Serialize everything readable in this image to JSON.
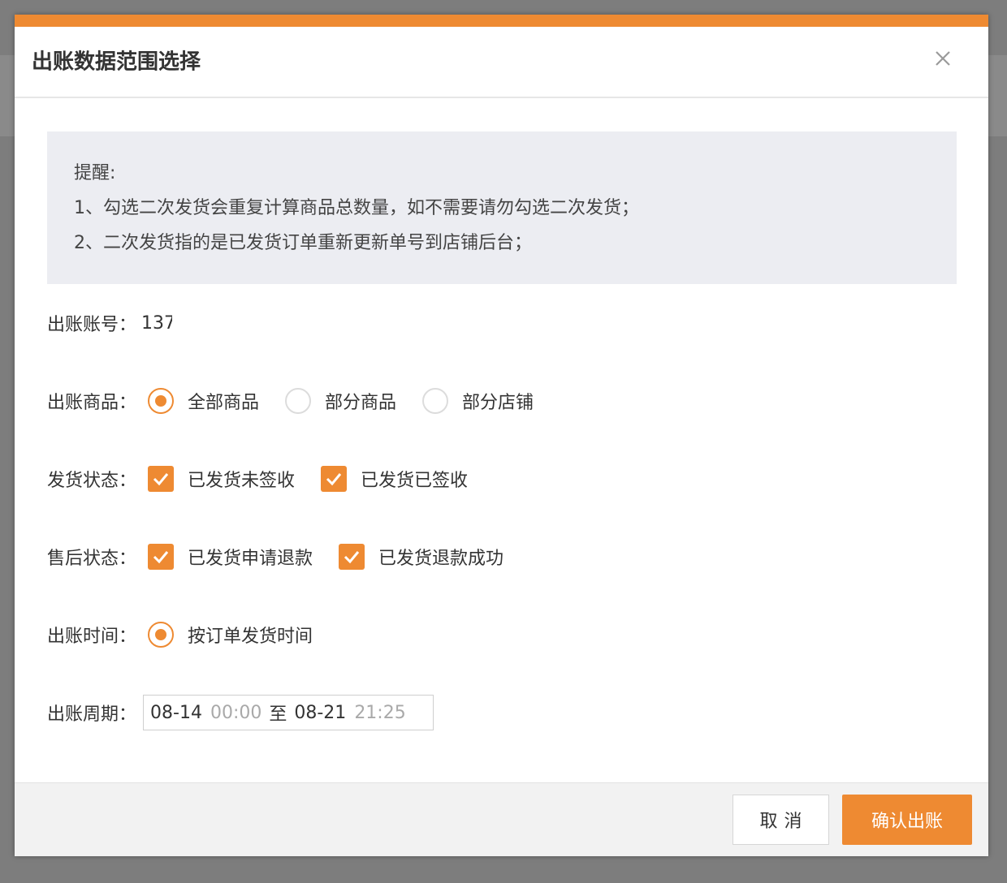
{
  "dialog": {
    "title": "出账数据范围选择",
    "accent_color": "#ee8a32"
  },
  "notice": {
    "title": "提醒:",
    "lines": [
      "1、勾选二次发货会重复计算商品总数量，如不需要请勿勾选二次发货；",
      "2、二次发货指的是已发货订单重新更新单号到店铺后台；"
    ]
  },
  "form": {
    "account": {
      "label": "出账账号：",
      "value": "137"
    },
    "goods": {
      "label": "出账商品：",
      "options": [
        {
          "label": "全部商品",
          "checked": true
        },
        {
          "label": "部分商品",
          "checked": false
        },
        {
          "label": "部分店铺",
          "checked": false
        }
      ]
    },
    "ship_status": {
      "label": "发货状态：",
      "options": [
        {
          "label": "已发货未签收",
          "checked": true
        },
        {
          "label": "已发货已签收",
          "checked": true
        }
      ]
    },
    "aftersale_status": {
      "label": "售后状态：",
      "options": [
        {
          "label": "已发货申请退款",
          "checked": true
        },
        {
          "label": "已发货退款成功",
          "checked": true
        }
      ]
    },
    "bill_time": {
      "label": "出账时间：",
      "options": [
        {
          "label": "按订单发货时间",
          "checked": true
        }
      ]
    },
    "period": {
      "label": "出账周期：",
      "start_date": "08-14",
      "start_time": "00:00",
      "separator": "至",
      "end_date": "08-21",
      "end_time": "21:25"
    }
  },
  "footer": {
    "cancel_label": "取消",
    "confirm_label": "确认出账"
  }
}
